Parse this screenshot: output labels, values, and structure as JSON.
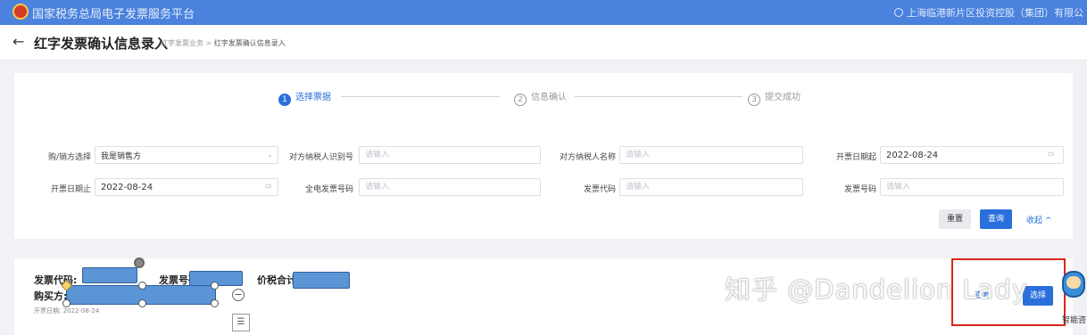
{
  "app": {
    "title": "国家税务总局电子发票服务平台",
    "user": "上海临港新片区投资控股（集团）有限公",
    "icons": {
      "logo": "tax-emblem-logo",
      "user": "user-icon"
    }
  },
  "header": {
    "back_icon": "←",
    "title": "红字发票确认信息录入",
    "breadcrumb": {
      "parent": "红字发票业务",
      "separator": ">",
      "current": "红字发票确认信息录入"
    }
  },
  "steps": [
    {
      "num": "1",
      "label": "选择票据",
      "state": "active"
    },
    {
      "num": "2",
      "label": "信息确认",
      "state": "pending"
    },
    {
      "num": "3",
      "label": "提交成功",
      "state": "pending"
    }
  ],
  "filters": {
    "role": {
      "label": "购/销方选择",
      "value": "我是销售方"
    },
    "tax_id": {
      "label": "对方纳税人识别号",
      "placeholder": "请输入"
    },
    "tax_name": {
      "label": "对方纳税人名称",
      "placeholder": "请输入"
    },
    "date_from": {
      "label": "开票日期起",
      "value": "2022-08-24"
    },
    "date_to": {
      "label": "开票日期止",
      "value": "2022-08-24"
    },
    "full_invoice_no": {
      "label": "全电发票号码",
      "placeholder": "请输入"
    },
    "invoice_code": {
      "label": "发票代码",
      "placeholder": "请输入"
    },
    "invoice_no": {
      "label": "发票号码",
      "placeholder": "请输入"
    },
    "reset_label": "重置",
    "query_label": "查询",
    "collapse_label": "收起 ^"
  },
  "invoice": {
    "code_label": "发票代码:",
    "number_label": "发票号码:",
    "total_label": "价税合计:",
    "buyer_label": "购买方:",
    "date_line": "开票日期: 2022-08-24"
  },
  "row_actions": {
    "view_label": "查看",
    "select_label": "选择"
  },
  "watermark": "知乎 @Dandelion Lady",
  "assistant_label": "智能咨",
  "colors": {
    "primary": "#2a6fdb",
    "topbar": "#4a82dd",
    "highlight": "#d9261c",
    "redaction": "#5b95d6"
  }
}
